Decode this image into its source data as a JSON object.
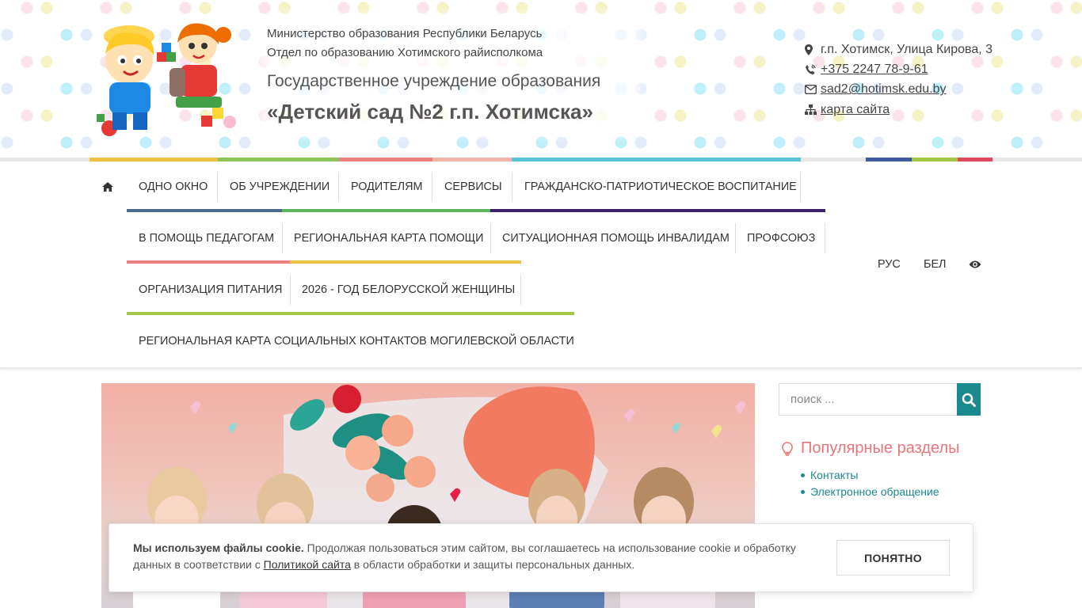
{
  "header": {
    "ministry_line1": "Министерство образования Республики Беларусь",
    "ministry_line2": "Отдел по образованию Хотимского райисполкома",
    "institution_type": "Государственное учреждение образования",
    "institution_name": "«Детский сад №2 г.п. Хотимска»"
  },
  "contacts": {
    "address": "г.п. Хотимск, Улица Кирова, 3",
    "phone": "+375 2247 78-9-61",
    "email": "sad2@hotimsk.edu.by",
    "sitemap": "карта сайта",
    "icons": [
      "map-marker-icon",
      "phone-icon",
      "envelope-icon",
      "sitemap-icon"
    ]
  },
  "nav": {
    "row1": [
      "ОДНО ОКНО",
      "ОБ УЧРЕЖДЕНИИ",
      "РОДИТЕЛЯМ",
      "СЕРВИСЫ",
      "ГРАЖДАНСКО-ПАТРИОТИЧЕСКОЕ ВОСПИТАНИЕ"
    ],
    "row2": [
      "В ПОМОЩЬ ПЕДАГОГАМ",
      "РЕГИОНАЛЬНАЯ КАРТА ПОМОЩИ",
      "СИТУАЦИОННАЯ ПОМОЩЬ ИНВАЛИДАМ",
      "ПРОФСОЮЗ"
    ],
    "row3": [
      "ОРГАНИЗАЦИЯ ПИТАНИЯ",
      "2026 - ГОД БЕЛОРУССКОЙ ЖЕНЩИНЫ"
    ],
    "row4": [
      "РЕГИОНАЛЬНАЯ КАРТА СОЦИАЛЬНЫХ КОНТАКТОВ МОГИЛЕВСКОЙ ОБЛАСТИ"
    ],
    "lang_ru": "РУС",
    "lang_by": "БЕЛ"
  },
  "search": {
    "placeholder": "поиск ..."
  },
  "popular": {
    "title": "Популярные разделы",
    "items": [
      "Контакты",
      "Электронное обращение"
    ]
  },
  "cookie": {
    "bold": "Мы используем файлы cookie.",
    "text_before": " Продолжая пользоваться этим сайтом, вы соглашаетесь на использование cookie и обработку данных в соответствии с ",
    "link": "Политикой сайта",
    "text_after": " в области обработки и защиты персональных данных.",
    "button": "ПОНЯТНО"
  },
  "colors": {
    "accent": "#1b8a8f",
    "popular_title": "#e8767a"
  }
}
